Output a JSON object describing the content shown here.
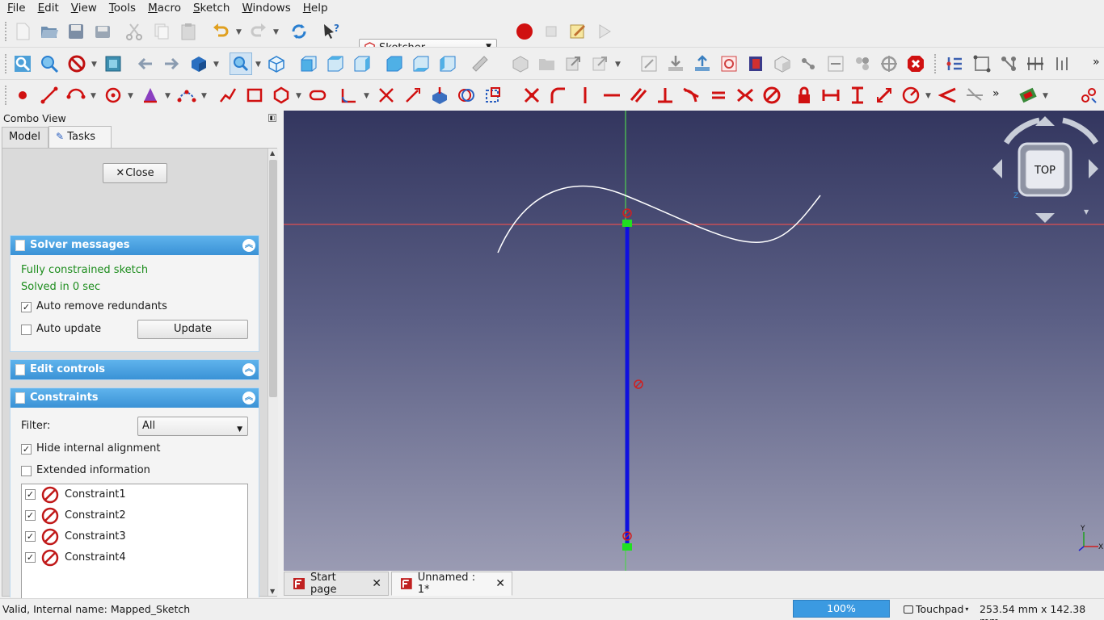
{
  "menubar": [
    "File",
    "Edit",
    "View",
    "Tools",
    "Macro",
    "Sketch",
    "Windows",
    "Help"
  ],
  "toolbar": {
    "workbench": "Sketcher"
  },
  "combo": {
    "title": "Combo View",
    "tabs": [
      "Model",
      "Tasks"
    ],
    "close_label": "Close",
    "solver": {
      "title": "Solver messages",
      "status": "Fully constrained sketch",
      "time": "Solved in 0 sec",
      "auto_remove_label": "Auto remove redundants",
      "auto_remove_checked": true,
      "auto_update_label": "Auto update",
      "auto_update_checked": false,
      "update_label": "Update"
    },
    "edit_controls": {
      "title": "Edit controls"
    },
    "constraints": {
      "title": "Constraints",
      "filter_label": "Filter:",
      "filter_value": "All",
      "hide_internal_label": "Hide internal alignment",
      "hide_internal_checked": true,
      "extended_label": "Extended information",
      "extended_checked": false,
      "items": [
        {
          "label": "Constraint1",
          "checked": true
        },
        {
          "label": "Constraint2",
          "checked": true
        },
        {
          "label": "Constraint3",
          "checked": true
        },
        {
          "label": "Constraint4",
          "checked": true
        }
      ]
    }
  },
  "view": {
    "navcube_face": "TOP",
    "axis_labels": {
      "y": "Y",
      "x": "X",
      "z": "Z"
    },
    "colors": {
      "x_axis": "#e05050",
      "y_axis": "#50d050",
      "line": "#1010e0",
      "curve": "#ffffff",
      "point": "#20e020",
      "constraint": "#d02020"
    }
  },
  "doctabs": [
    {
      "label": "Start page",
      "active": false
    },
    {
      "label": "Unnamed : 1*",
      "active": true
    }
  ],
  "statusbar": {
    "message": "Valid, Internal name: Mapped_Sketch",
    "progress": "100%",
    "nav_style": "Touchpad",
    "dimensions": "253.54 mm x 142.38 mm"
  }
}
